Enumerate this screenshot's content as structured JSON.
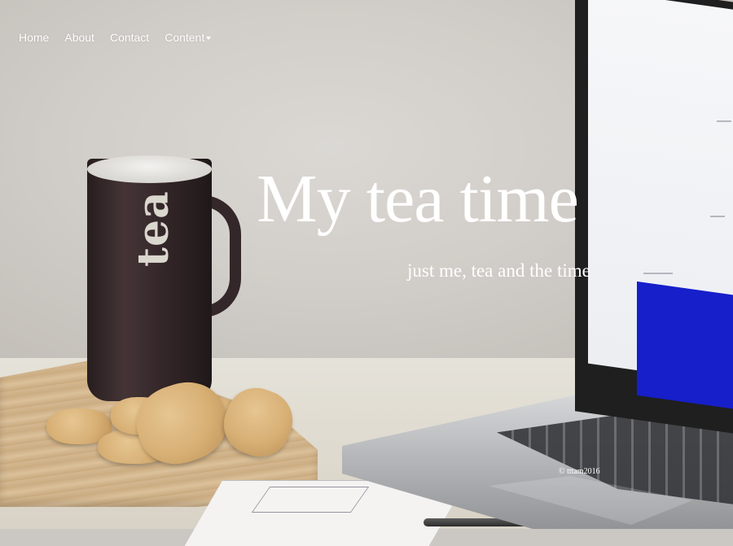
{
  "nav": {
    "items": [
      {
        "label": "Home"
      },
      {
        "label": "About"
      },
      {
        "label": "Contact"
      },
      {
        "label": "Content"
      }
    ]
  },
  "hero": {
    "title": "My tea time",
    "subtitle": "just me, tea and the time"
  },
  "background": {
    "mug_text": "tea"
  },
  "footer": {
    "copyright": "© tttam2016"
  },
  "colors": {
    "text": "#ffffff",
    "screen_accent": "#0a13c7"
  }
}
